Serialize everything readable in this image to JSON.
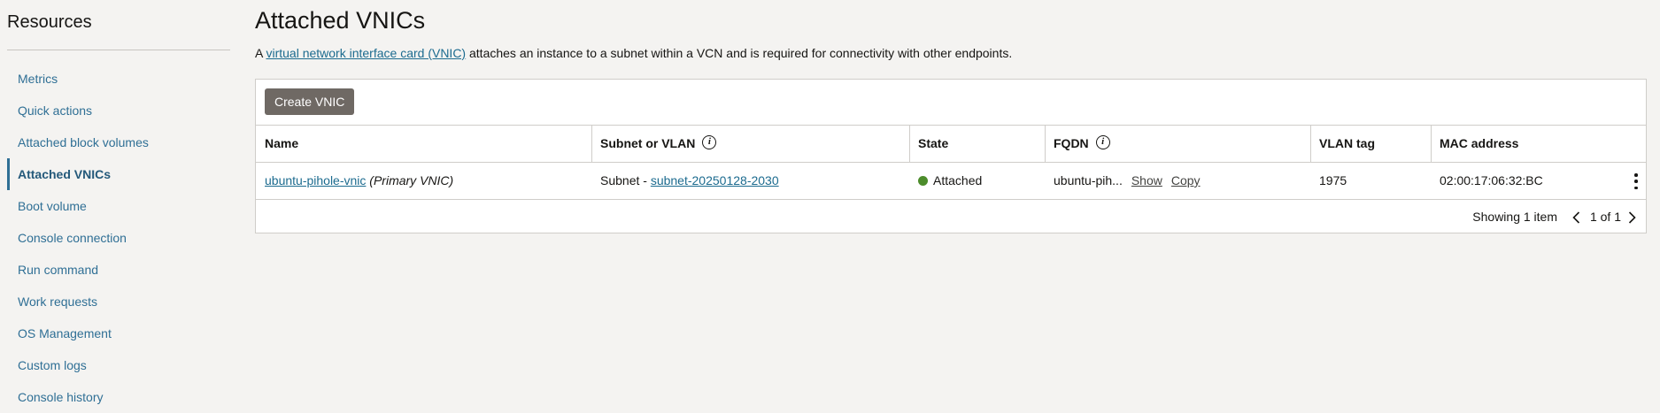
{
  "sidebar": {
    "title": "Resources",
    "items": [
      {
        "label": "Metrics"
      },
      {
        "label": "Quick actions"
      },
      {
        "label": "Attached block volumes"
      },
      {
        "label": "Attached VNICs"
      },
      {
        "label": "Boot volume"
      },
      {
        "label": "Console connection"
      },
      {
        "label": "Run command"
      },
      {
        "label": "Work requests"
      },
      {
        "label": "OS Management"
      },
      {
        "label": "Custom logs"
      },
      {
        "label": "Console history"
      }
    ],
    "active_item": "Attached VNICs"
  },
  "main": {
    "title": "Attached VNICs",
    "description": {
      "prefix": "A ",
      "link": "virtual network interface card (VNIC)",
      "suffix": " attaches an instance to a subnet within a VCN and is required for connectivity with other endpoints."
    },
    "create_button": "Create VNIC",
    "columns": [
      "Name",
      "Subnet or VLAN",
      "State",
      "FQDN",
      "VLAN tag",
      "MAC address"
    ],
    "rows": [
      {
        "name": "ubuntu-pihole-vnic",
        "name_suffix": "(Primary VNIC)",
        "subnet_prefix": "Subnet - ",
        "subnet": "subnet-20250128-2030",
        "state": "Attached",
        "fqdn": "ubuntu-pih...",
        "fqdn_show": "Show",
        "fqdn_copy": "Copy",
        "vlan_tag": "1975",
        "mac_address": "02:00:17:06:32:BC"
      }
    ],
    "pagination": {
      "showing": "Showing 1 item",
      "page": "1 of 1"
    }
  },
  "colors": {
    "accent_link": "#1c6b8f",
    "state_attached": "#4c8c2b",
    "button_bg": "#6f6964"
  }
}
